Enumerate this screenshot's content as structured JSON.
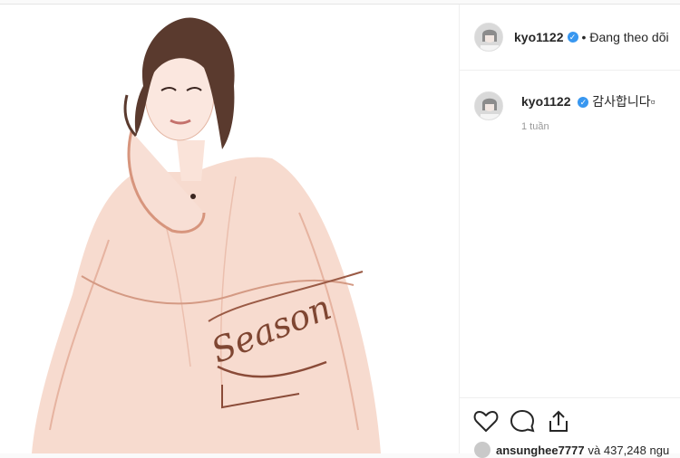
{
  "post": {
    "image_watermark": "Season",
    "header": {
      "username": "kyo1122",
      "separator": "•",
      "follow_status": "Đang theo dõi"
    },
    "comments": [
      {
        "username": "kyo1122",
        "text": "감사합니다▫",
        "time": "1 tuần"
      }
    ],
    "actions": {
      "icons": [
        "heart-icon",
        "comment-icon",
        "share-icon"
      ]
    },
    "likes": {
      "user": "ansunghee7777",
      "text": "và 437,248 ngu"
    },
    "colors": {
      "verified": "#3897f0",
      "illustration_dress": "#f3cdbd",
      "hair": "#5a3a2e"
    }
  }
}
